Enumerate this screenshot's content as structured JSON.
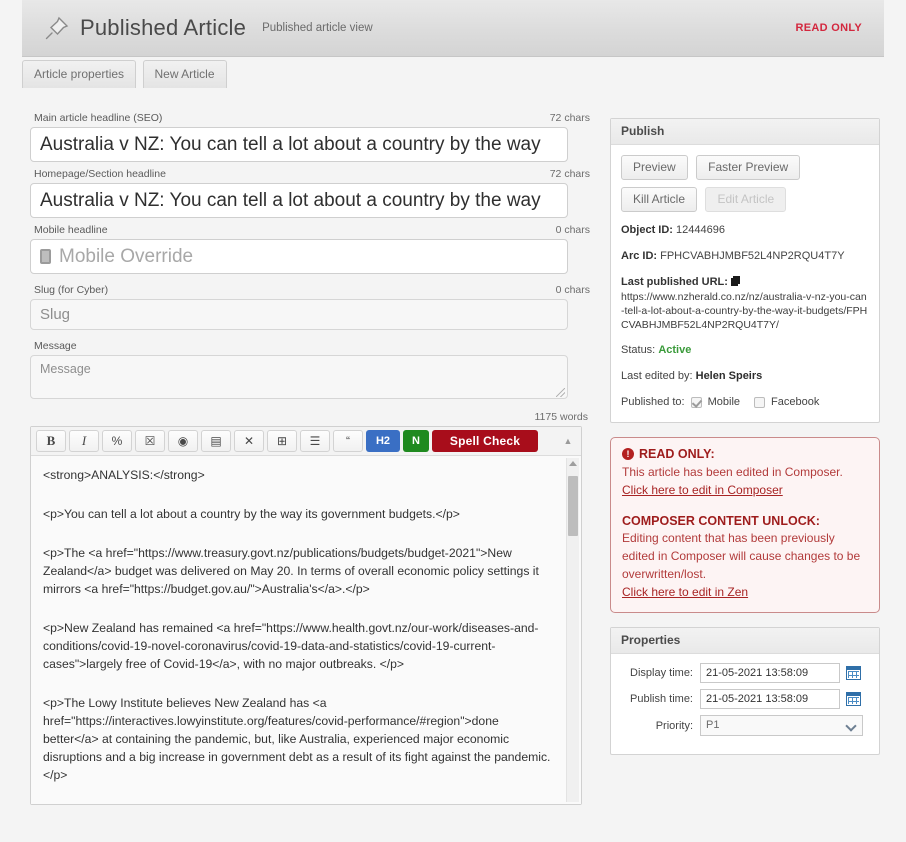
{
  "header": {
    "icon": "pin-icon",
    "title": "Published Article",
    "subtitle": "Published article view",
    "readonly_flag": "READ ONLY",
    "readonly_color": "#d3273e"
  },
  "tabs": [
    {
      "label": "Article properties"
    },
    {
      "label": "New Article"
    }
  ],
  "fields": {
    "main_headline": {
      "label": "Main article headline (SEO)",
      "value": "Australia v NZ: You can tell a lot about a country by the way",
      "charcount": "72 chars"
    },
    "homepage_headline": {
      "label": "Homepage/Section headline",
      "value": "Australia v NZ: You can tell a lot about a country by the way",
      "charcount": "72 chars"
    },
    "mobile_headline": {
      "label": "Mobile headline",
      "value": "",
      "placeholder": "Mobile Override",
      "charcount": "0 chars"
    },
    "slug": {
      "label": "Slug (for Cyber)",
      "value": "",
      "placeholder": "Slug",
      "charcount": "0 chars"
    },
    "message": {
      "label": "Message",
      "value": "",
      "placeholder": "Message"
    }
  },
  "editor": {
    "wordcount": "1175 words",
    "toolbar": [
      {
        "name": "bold-button",
        "glyph": "B",
        "kind": "b"
      },
      {
        "name": "italic-button",
        "glyph": "I",
        "kind": "i"
      },
      {
        "name": "link-icon",
        "glyph": "%",
        "kind": "plain"
      },
      {
        "name": "image-icon",
        "glyph": "☒",
        "kind": "plain"
      },
      {
        "name": "camera-icon",
        "glyph": "◉",
        "kind": "plain"
      },
      {
        "name": "video-icon",
        "glyph": "▤",
        "kind": "plain"
      },
      {
        "name": "remove-format-icon",
        "glyph": "✕",
        "kind": "plain"
      },
      {
        "name": "table-icon",
        "glyph": "⊞",
        "kind": "plain"
      },
      {
        "name": "list-icon",
        "glyph": "☰",
        "kind": "plain"
      },
      {
        "name": "blockquote-icon",
        "glyph": "“",
        "kind": "plain"
      },
      {
        "name": "heading2-button",
        "glyph": "H2",
        "kind": "h2",
        "color": "#3a6fc4"
      },
      {
        "name": "note-button",
        "glyph": "N",
        "kind": "n",
        "color": "#1f8a1f"
      },
      {
        "name": "spell-check-button",
        "glyph": "Spell Check",
        "kind": "spell",
        "color": "#a80d1b"
      }
    ],
    "collapse_glyph": "▲",
    "content": [
      "<strong>ANALYSIS:</strong>",
      "<p>You can tell a lot about a country by the way its government budgets.</p>",
      "<p>The <a href=\"https://www.treasury.govt.nz/publications/budgets/budget-2021\">New Zealand</a> budget was delivered on May 20. In terms of overall economic policy settings it mirrors <a href=\"https://budget.gov.au/\">Australia's</a>.</p>",
      "<p>New Zealand has remained <a href=\"https://www.health.govt.nz/our-work/diseases-and-conditions/covid-19-novel-coronavirus/covid-19-data-and-statistics/covid-19-current-cases\">largely free of Covid-19</a>, with no major outbreaks. </p>",
      "<p>The Lowy Institute believes New Zealand has <a href=\"https://interactives.lowyinstitute.org/features/covid-performance/#region\">done better</a> at containing the pandemic, but, like Australia, experienced major economic disruptions and a big increase in government debt as a result of its fight against the pandemic.</p>"
    ]
  },
  "publish": {
    "title": "Publish",
    "buttons": [
      {
        "label": "Preview",
        "disabled": false
      },
      {
        "label": "Faster Preview",
        "disabled": false
      },
      {
        "label": "Kill Article",
        "disabled": false
      },
      {
        "label": "Edit Article",
        "disabled": true
      }
    ],
    "object_id_label": "Object ID:",
    "object_id_value": "12444696",
    "arc_id_label": "Arc ID:",
    "arc_id_value": "FPHCVABHJMBF52L4NP2RQU4T7Y",
    "last_url_label": "Last published URL:",
    "last_url_value": "https://www.nzherald.co.nz/nz/australia-v-nz-you-can-tell-a-lot-about-a-country-by-the-way-it-budgets/FPHCVABHJMBF52L4NP2RQU4T7Y/",
    "status_label": "Status:",
    "status_value": "Active",
    "status_color": "#3a9a3a",
    "last_edited_label": "Last edited by:",
    "last_edited_value": "Helen Speirs",
    "published_to_label": "Published to:",
    "published_to": [
      {
        "label": "Mobile",
        "checked": true
      },
      {
        "label": "Facebook",
        "checked": false
      }
    ]
  },
  "warning": {
    "title": "READ ONLY:",
    "body": "This article has been edited in Composer.",
    "link1": "Click here to edit in Composer",
    "subtitle": "COMPOSER CONTENT UNLOCK:",
    "body2": "Editing content that has been previously edited in Composer will cause changes to be overwritten/lost.",
    "link2": "Click here to edit in Zen",
    "border_color": "#c98b8b",
    "bg_color": "#fdf4f4",
    "text_color": "#b23b3b",
    "title_color": "#9e1c1c"
  },
  "properties": {
    "title": "Properties",
    "rows": [
      {
        "label": "Display time:",
        "value": "21-05-2021 13:58:09",
        "type": "date"
      },
      {
        "label": "Publish time:",
        "value": "21-05-2021 13:58:09",
        "type": "date"
      },
      {
        "label": "Priority:",
        "value": "P1",
        "type": "select"
      }
    ]
  }
}
